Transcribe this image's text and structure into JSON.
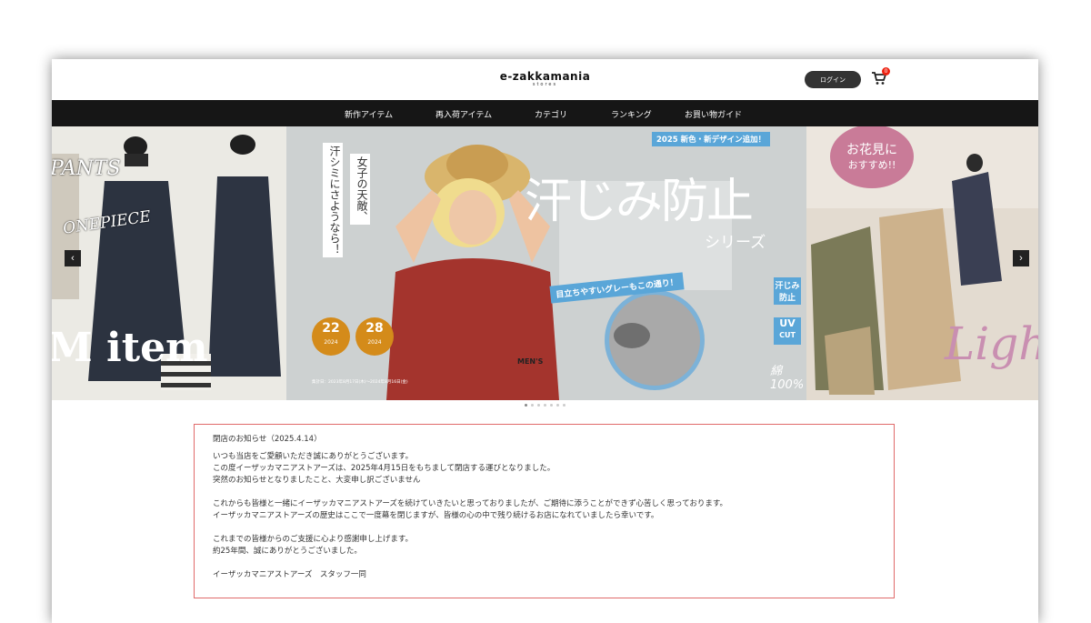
{
  "header": {
    "logo_main": "e-zakkamania",
    "logo_sub": "stores",
    "login_label": "ログイン",
    "cart_count": "0"
  },
  "nav": {
    "items": [
      "新作アイテム",
      "再入荷アイテム",
      "カテゴリ",
      "ランキング",
      "お買い物ガイド"
    ]
  },
  "hero": {
    "left_slide": {
      "text_pants": "PANTS",
      "text_onepiece": "ONEPIECE",
      "text_item": "M item"
    },
    "main_slide": {
      "badge_top": "2025 新色・新デザイン追加！",
      "vertical_text_1": "女子の天敵、",
      "vertical_text_2": "汗シミにさようなら！",
      "title": "汗じみ防止",
      "subtitle": "シリーズ",
      "banner": "目立ちやすいグレーもこの通り！",
      "tag_1": "汗じみ防止",
      "tag_2_line1": "UV",
      "tag_2_line2": "CUT",
      "cotton": "綿100%",
      "mens": "MEN'S",
      "medal_1_num": "22",
      "medal_1_year": "2024",
      "medal_2_num": "28",
      "medal_2_year": "2024",
      "footnote": "集計日：2023年8月17日(木)〜2024年8月16日(金)"
    },
    "right_slide": {
      "circle_line1": "お花見に",
      "circle_line2": "おすすめ!!",
      "script_text": "Ligh"
    },
    "prev_icon": "‹",
    "next_icon": "›"
  },
  "notice": {
    "title": "閉店のお知らせ（2025.4.14）",
    "paragraphs": [
      [
        "いつも当店をご愛顧いただき誠にありがとうございます。",
        "この度イーザッカマニアストアーズは、2025年4月15日をもちまして閉店する運びとなりました。",
        "突然のお知らせとなりましたこと、大変申し訳ございません"
      ],
      [
        "これからも皆様と一緒にイーザッカマニアストアーズを続けていきたいと思っておりましたが、ご期待に添うことができず心苦しく思っております。",
        "イーザッカマニアストアーズの歴史はここで一度幕を閉じますが、皆様の心の中で残り続けるお店になれていましたら幸いです。"
      ],
      [
        "これまでの皆様からのご支援に心より感謝申し上げます。",
        "約25年間、誠にありがとうございました。"
      ],
      [
        "イーザッカマニアストアーズ　スタッフ一同"
      ]
    ]
  },
  "colors": {
    "nav_bg": "#161616",
    "notice_border": "#e06a6a",
    "badge_blue": "#5aa6d8",
    "cart_badge": "#e21111"
  }
}
